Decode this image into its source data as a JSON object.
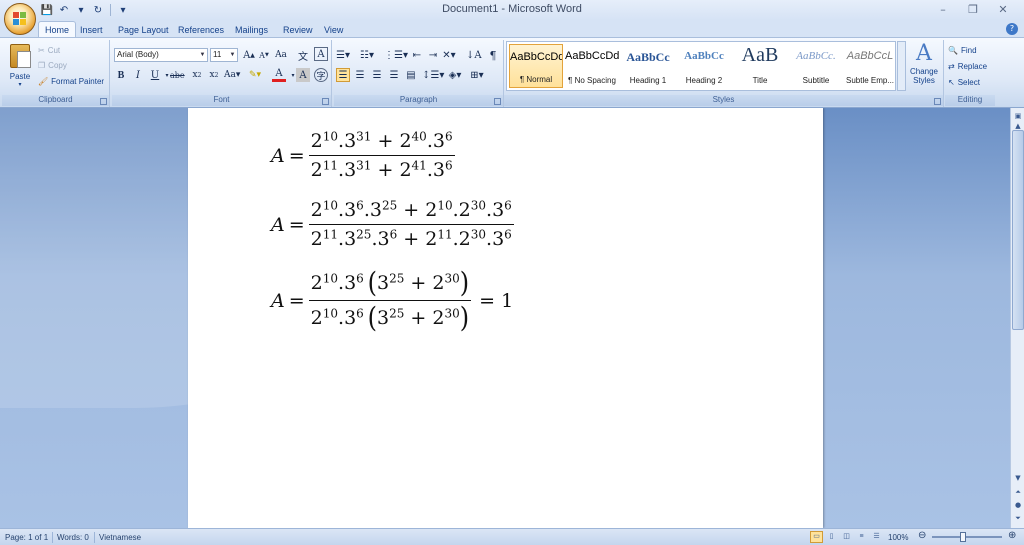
{
  "window": {
    "title": "Document1 - Microsoft Word",
    "controls": [
      "–",
      "❐",
      "✕"
    ]
  },
  "qat": {
    "save": "💾",
    "undo": "↶",
    "redo": "↻",
    "customize": "▾"
  },
  "tabs": [
    {
      "label": "Home",
      "active": true
    },
    {
      "label": "Insert"
    },
    {
      "label": "Page Layout"
    },
    {
      "label": "References"
    },
    {
      "label": "Mailings"
    },
    {
      "label": "Review"
    },
    {
      "label": "View"
    }
  ],
  "ribbon": {
    "clipboard": {
      "label": "Clipboard",
      "paste": "Paste",
      "cut": "Cut",
      "copy": "Copy",
      "format_painter": "Format Painter"
    },
    "font": {
      "label": "Font",
      "face": "Arial (Body)",
      "size": "11"
    },
    "paragraph": {
      "label": "Paragraph"
    },
    "styles": {
      "label": "Styles",
      "items": [
        {
          "sample": "AaBbCcDd",
          "name": "¶ Normal"
        },
        {
          "sample": "AaBbCcDd",
          "name": "¶ No Spacing"
        },
        {
          "sample": "AaBbCc",
          "name": "Heading 1"
        },
        {
          "sample": "AaBbCc",
          "name": "Heading 2"
        },
        {
          "sample": "AaB",
          "name": "Title"
        },
        {
          "sample": "AaBbCc.",
          "name": "Subtitle"
        },
        {
          "sample": "AaBbCcL",
          "name": "Subtle Emp..."
        }
      ],
      "change_styles": "Change Styles"
    },
    "editing": {
      "label": "Editing",
      "find": "Find",
      "replace": "Replace",
      "select": "Select"
    }
  },
  "equations": [
    {
      "lhs": "A",
      "num": [
        [
          "2",
          "10"
        ],
        [
          ".3",
          "31"
        ],
        [
          " + 2",
          "40"
        ],
        [
          ".3",
          "6"
        ]
      ],
      "den": [
        [
          "2",
          "11"
        ],
        [
          ".3",
          "31"
        ],
        [
          " + 2",
          "41"
        ],
        [
          ".3",
          "6"
        ]
      ],
      "rhs": ""
    },
    {
      "lhs": "A",
      "num": [
        [
          "2",
          "10"
        ],
        [
          ".3",
          "6"
        ],
        [
          ".3",
          "25"
        ],
        [
          " + 2",
          "10"
        ],
        [
          ".2",
          "30"
        ],
        [
          ".3",
          "6"
        ]
      ],
      "den": [
        [
          "2",
          "11"
        ],
        [
          ".3",
          "25"
        ],
        [
          ".3",
          "6"
        ],
        [
          " + 2",
          "11"
        ],
        [
          ".2",
          "30"
        ],
        [
          ".3",
          "6"
        ]
      ],
      "rhs": ""
    },
    {
      "lhs": "A",
      "num_prefix": [
        [
          "2",
          "10"
        ],
        [
          ".3",
          "6"
        ]
      ],
      "num_paren": [
        [
          "3",
          "25"
        ],
        [
          " + 2",
          "30"
        ]
      ],
      "den_prefix": [
        [
          "2",
          "10"
        ],
        [
          ".3",
          "6"
        ]
      ],
      "den_paren": [
        [
          "3",
          "25"
        ],
        [
          " + 2",
          "30"
        ]
      ],
      "rhs": "= 1"
    }
  ],
  "status": {
    "page": "Page: 1 of 1",
    "words": "Words: 0",
    "language": "Vietnamese",
    "zoom": "100%"
  }
}
